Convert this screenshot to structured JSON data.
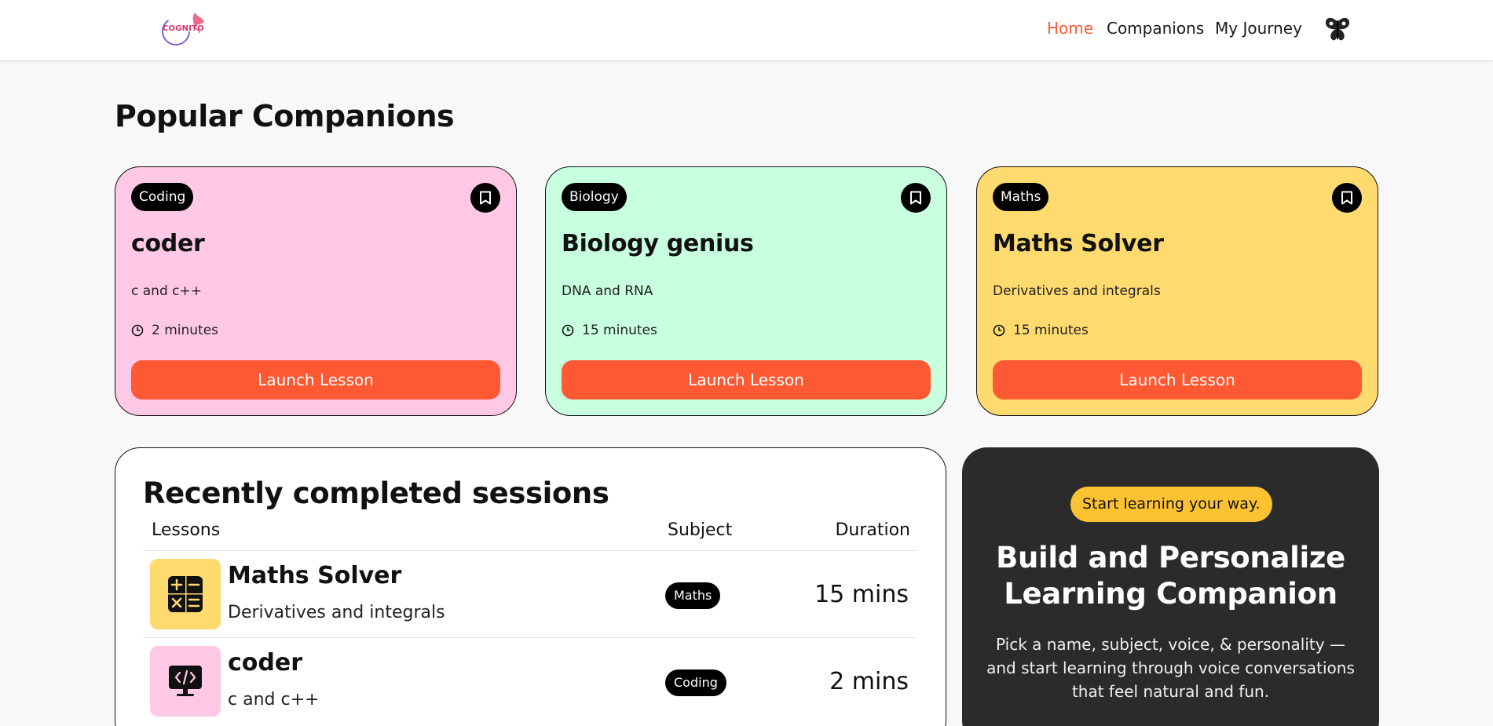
{
  "nav": {
    "logo_text": "COGNITO",
    "links": [
      {
        "label": "Home",
        "active": true
      },
      {
        "label": "Companions",
        "active": false
      },
      {
        "label": "My Journey",
        "active": false
      }
    ]
  },
  "popular": {
    "title": "Popular Companions",
    "cards": [
      {
        "subject": "Coding",
        "name": "coder",
        "topic": "c and c++",
        "duration": "2 minutes",
        "button": "Launch Lesson",
        "color": "#ffc8e4"
      },
      {
        "subject": "Biology",
        "name": "Biology genius",
        "topic": "DNA and RNA",
        "duration": "15 minutes",
        "button": "Launch Lesson",
        "color": "#c8ffdf"
      },
      {
        "subject": "Maths",
        "name": "Maths Solver",
        "topic": "Derivatives and integrals",
        "duration": "15 minutes",
        "button": "Launch Lesson",
        "color": "#ffda6e"
      }
    ]
  },
  "recent": {
    "title": "Recently completed sessions",
    "headers": {
      "lessons": "Lessons",
      "subject": "Subject",
      "duration": "Duration"
    },
    "rows": [
      {
        "name": "Maths Solver",
        "topic": "Derivatives and integrals",
        "subject": "Maths",
        "duration": "15 mins",
        "icon": "calculator-icon",
        "color": "#ffda6e"
      },
      {
        "name": "coder",
        "topic": "c and c++",
        "subject": "Coding",
        "duration": "2 mins",
        "icon": "code-monitor-icon",
        "color": "#ffc8e4"
      }
    ]
  },
  "cta": {
    "badge": "Start learning your way.",
    "title_line1": "Build and Personalize",
    "title_line2": "Learning Companion",
    "description": "Pick a name, subject, voice, & personality — and start learning through voice conversations that feel natural and fun."
  },
  "colors": {
    "accent": "#fe5933",
    "active_nav": "#fe5933",
    "cta_bg": "#2b2b2b",
    "cta_badge": "#fcc232"
  }
}
